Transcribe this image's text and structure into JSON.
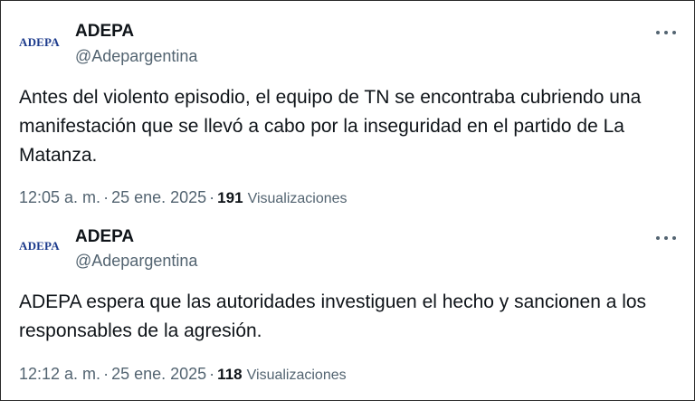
{
  "tweets": [
    {
      "avatar_text": "ADEPA",
      "name": "ADEPA",
      "handle": "@Adepargentina",
      "text": "Antes del violento episodio, el equipo de TN se encontraba cubriendo una manifestación que se llevó a cabo por la inseguridad en el partido de La Matanza.",
      "time": "12:05 a. m.",
      "date": "25 ene. 2025",
      "view_count": "191",
      "views_label": "Visualizaciones",
      "separator": "·"
    },
    {
      "avatar_text": "ADEPA",
      "name": "ADEPA",
      "handle": "@Adepargentina",
      "text": "ADEPA espera que las autoridades investiguen el hecho y sancionen a los responsables de la agresión.",
      "time": "12:12 a. m.",
      "date": "25 ene. 2025",
      "view_count": "118",
      "views_label": "Visualizaciones",
      "separator": "·"
    }
  ],
  "icons": {
    "more": "more-options-icon"
  },
  "colors": {
    "text_primary": "#0f1419",
    "text_secondary": "#536471",
    "logo_blue": "#1b3a8c",
    "background": "#ffffff"
  }
}
